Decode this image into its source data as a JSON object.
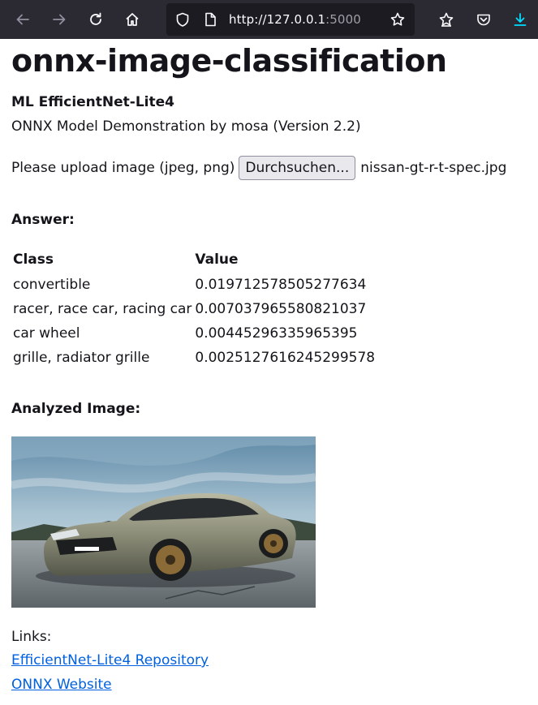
{
  "browser": {
    "url_main": "http://127.0.0.1",
    "url_port": ":5000",
    "icons": [
      "back-arrow-icon",
      "forward-arrow-icon",
      "reload-icon",
      "home-icon",
      "shield-icon",
      "page-icon",
      "bookmark-star-icon",
      "extensions-icon",
      "pocket-icon",
      "download-icon"
    ],
    "accent": "#00ddff"
  },
  "page": {
    "title": "onnx-image-classification",
    "subtitle": "ML EfficientNet-Lite4",
    "description": "ONNX Model Demonstration by mosa (Version 2.2)",
    "upload_label": "Please upload image (jpeg, png)",
    "upload_button": "Durchsuchen...",
    "upload_filename": "nissan-gt-r-t-spec.jpg",
    "answer_heading": "Answer:",
    "results": {
      "headers": [
        "Class",
        "Value"
      ],
      "rows": [
        [
          "convertible",
          "0.019712578505277634"
        ],
        [
          "racer, race car, racing car",
          "0.007037965580821037"
        ],
        [
          "car wheel",
          "0.00445296335965395"
        ],
        [
          "grille, radiator grille",
          "0.0025127616245299578"
        ]
      ]
    },
    "analyzed_heading": "Analyzed Image:",
    "links_heading": "Links:",
    "links": [
      "EfficientNet-Lite4 Repository",
      "ONNX Website"
    ],
    "link_color": "#0060df"
  }
}
